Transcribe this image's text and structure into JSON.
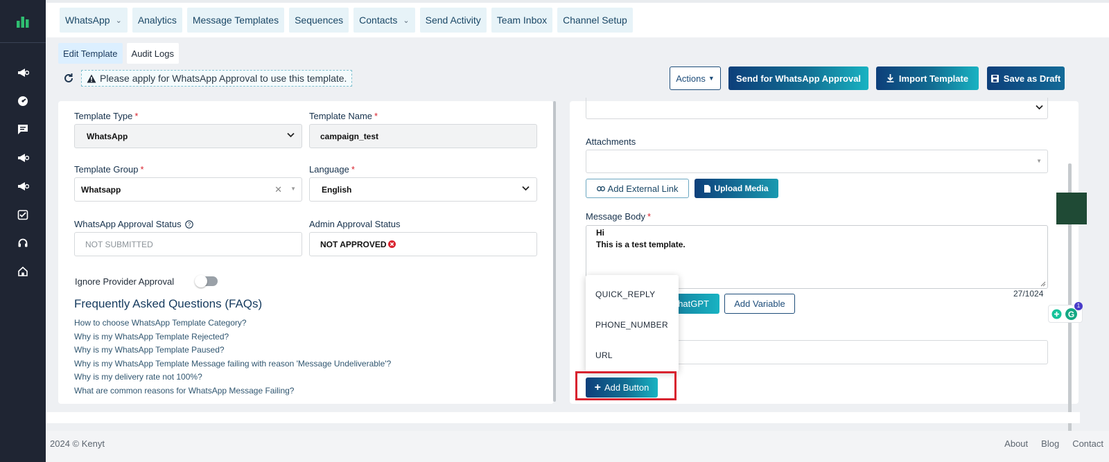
{
  "topnav": {
    "tabs": [
      {
        "label": "WhatsApp",
        "has_dropdown": true
      },
      {
        "label": "Analytics",
        "has_dropdown": false
      },
      {
        "label": "Message Templates",
        "has_dropdown": false
      },
      {
        "label": "Sequences",
        "has_dropdown": false
      },
      {
        "label": "Contacts",
        "has_dropdown": true
      },
      {
        "label": "Send Activity",
        "has_dropdown": false
      },
      {
        "label": "Team Inbox",
        "has_dropdown": false
      },
      {
        "label": "Channel Setup",
        "has_dropdown": false
      }
    ]
  },
  "subtabs": {
    "edit": "Edit Template",
    "audit": "Audit Logs"
  },
  "notice": {
    "text": "Please apply for WhatsApp Approval to use this template."
  },
  "toolbar": {
    "actions_label": "Actions",
    "approval_label": "Send for WhatsApp Approval",
    "import_label": "Import Template",
    "draft_label": "Save as Draft"
  },
  "form": {
    "template_type": {
      "label": "Template Type",
      "value": "WhatsApp"
    },
    "template_name": {
      "label": "Template Name",
      "value": "campaign_test"
    },
    "template_group": {
      "label": "Template Group",
      "value": "Whatsapp"
    },
    "language": {
      "label": "Language",
      "value": "English"
    },
    "wa_status": {
      "label": "WhatsApp Approval Status",
      "value": "NOT SUBMITTED"
    },
    "admin_status": {
      "label": "Admin Approval Status",
      "value": "NOT APPROVED"
    },
    "ignore_label": "Ignore Provider Approval"
  },
  "faq": {
    "title": "Frequently Asked Questions (FAQs)",
    "items": [
      "How to choose WhatsApp Template Category?",
      "Why is my WhatsApp Template Rejected?",
      "Why is my WhatsApp Template Paused?",
      "Why is my WhatsApp Template Message failing with reason 'Message Undeliverable'?",
      "Why is my delivery rate not 100%?",
      "What are common reasons for WhatsApp Message Failing?"
    ]
  },
  "right": {
    "attachments_label": "Attachments",
    "add_link_label": "Add External Link",
    "upload_label": "Upload Media",
    "body_label": "Message Body",
    "body_line1": "Hi",
    "body_line2": "This is a test template.",
    "counter": "27/1024",
    "chatgpt_label": "ChatGPT",
    "add_variable_label": "Add Variable",
    "add_button_label": "Add Button",
    "grammarly_count": "1",
    "dropdown": [
      "QUICK_REPLY",
      "PHONE_NUMBER",
      "URL"
    ]
  },
  "footer": {
    "copyright": "2024 © Kenyt",
    "links": [
      "About",
      "Blog",
      "Contact"
    ]
  },
  "colors": {
    "sidebar": "#1f2533",
    "primary": "#0d3f7a",
    "accent": "#19b3c2",
    "required": "#d9232e",
    "highlight": "#d8232f"
  },
  "icons": {
    "sidebar": [
      "megaphone-icon",
      "gauge-icon",
      "chat-icon",
      "megaphone-icon",
      "megaphone-icon",
      "checklist-icon",
      "headset-icon",
      "home-icon"
    ]
  }
}
